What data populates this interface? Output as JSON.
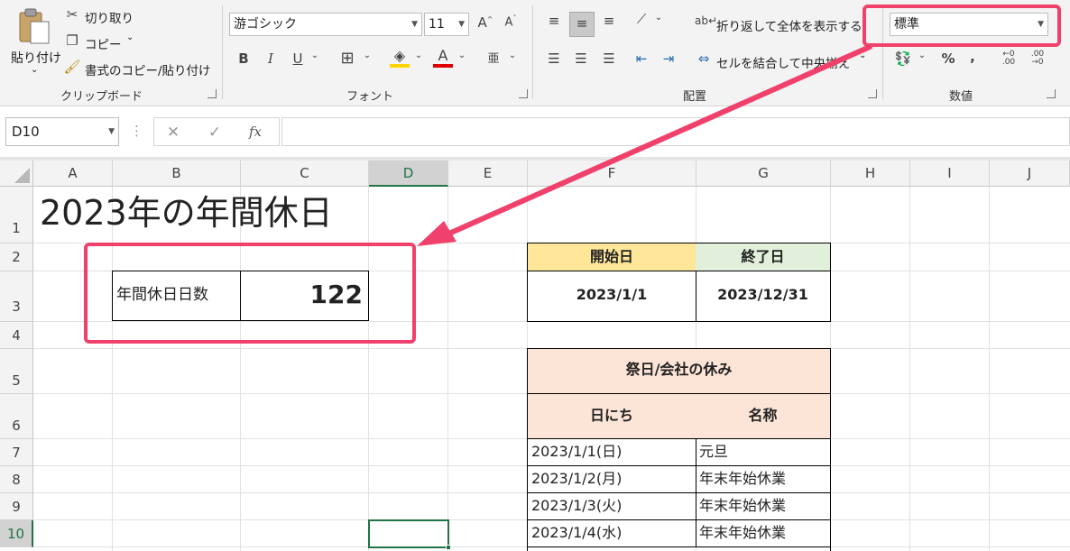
{
  "ribbon": {
    "clipboard": {
      "paste_label": "貼り付け",
      "cut_label": "切り取り",
      "copy_label": "コピー",
      "format_painter_label": "書式のコピー/貼り付け",
      "group_label": "クリップボード"
    },
    "font": {
      "font_name": "游ゴシック",
      "font_size": "11",
      "group_label": "フォント"
    },
    "alignment": {
      "wrap_text_label": "折り返して全体を表示する",
      "merge_center_label": "セルを結合して中央揃え",
      "group_label": "配置"
    },
    "number": {
      "format_value": "標準",
      "group_label": "数値"
    }
  },
  "formula_bar": {
    "name_box": "D10",
    "fx_label": "fx",
    "formula": ""
  },
  "columns": [
    "A",
    "B",
    "C",
    "D",
    "E",
    "F",
    "G",
    "H",
    "I",
    "J"
  ],
  "rows": [
    "1",
    "2",
    "3",
    "4",
    "5",
    "6",
    "7",
    "8",
    "9",
    "10"
  ],
  "sheet": {
    "title": "2023年の年間休日",
    "annual_label": "年間休日日数",
    "annual_value": "122",
    "start_header": "開始日",
    "end_header": "終了日",
    "start_value": "2023/1/1",
    "end_value": "2023/12/31",
    "holidays_header": "祭日/会社の休み",
    "date_header": "日にち",
    "name_header": "名称",
    "holidays": [
      {
        "date": "2023/1/1(日)",
        "name": "元旦"
      },
      {
        "date": "2023/1/2(月)",
        "name": "年末年始休業"
      },
      {
        "date": "2023/1/3(火)",
        "name": "年末年始休業"
      },
      {
        "date": "2023/1/4(水)",
        "name": "年末年始休業"
      }
    ]
  },
  "colors": {
    "accent_annotation": "#f0416c",
    "start_header_fill": "#ffe699",
    "end_header_fill": "#e2efda",
    "holiday_header_fill": "#fce4d6",
    "selected_cell_border": "#217346"
  }
}
